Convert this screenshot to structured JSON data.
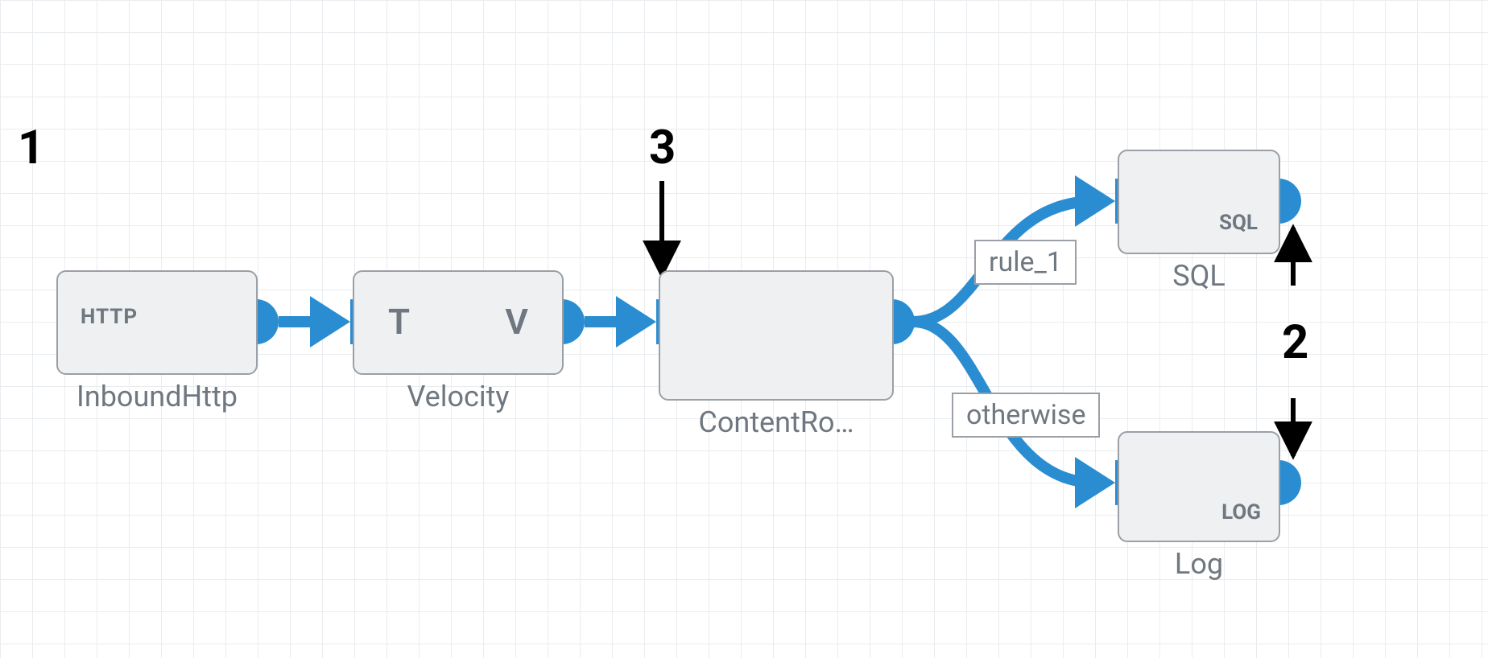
{
  "diagram": {
    "nodes": {
      "inbound_http": {
        "label": "InboundHttp",
        "icon_text": "HTTP"
      },
      "velocity": {
        "label": "Velocity",
        "icon_left": "T",
        "icon_right": "V"
      },
      "content_router": {
        "label": "ContentRo…"
      },
      "sql": {
        "label": "SQL",
        "badge": "SQL"
      },
      "log": {
        "label": "Log",
        "badge": "LOG"
      }
    },
    "edges": {
      "rule_1": {
        "label": "rule_1"
      },
      "otherwise": {
        "label": "otherwise"
      }
    },
    "annotations": {
      "a1": "1",
      "a2": "2",
      "a3": "3"
    }
  },
  "colors": {
    "blue": "#2a8dd2",
    "grey": "#6f7780",
    "node_border": "#9aa0a6",
    "node_fill": "#eef0f2"
  }
}
